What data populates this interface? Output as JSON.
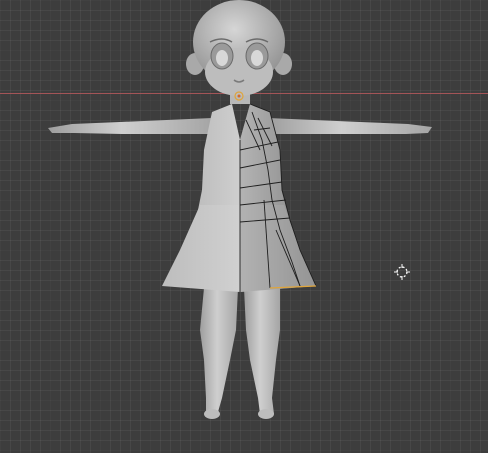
{
  "viewport": {
    "colors": {
      "background": "#3d3d3d",
      "x_axis": "#b5585c",
      "mesh_light": "#c8c8c8",
      "mesh_mid": "#a9a9a9",
      "mesh_dark": "#7c7c7c",
      "wire": "#1e1e1e",
      "selection": "#e0a53a"
    },
    "icons": {
      "cursor": "3d-cursor-icon"
    }
  }
}
